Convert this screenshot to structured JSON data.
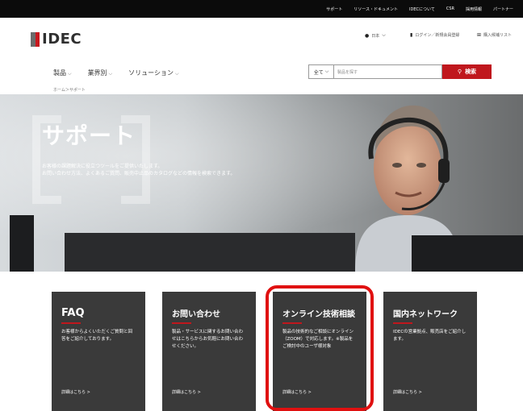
{
  "topbar": {
    "links": [
      "サポート",
      "リソース・ドキュメント",
      "IDECについて",
      "CSR",
      "採用情報",
      "パートナー"
    ]
  },
  "header": {
    "logo_text": "IDEC",
    "region_label": "日本",
    "login_label": "ログイン／新規会員登録",
    "cart_label": "購入候補リスト"
  },
  "nav": {
    "items": [
      {
        "label": "製品"
      },
      {
        "label": "業界別"
      },
      {
        "label": "ソリューション"
      }
    ]
  },
  "search": {
    "scope_value": "全て",
    "placeholder": "製品を探す",
    "button_label": "検索"
  },
  "breadcrumb": "ホーム＞サポート",
  "hero": {
    "title": "サポート",
    "desc_line1": "お客様の課題解決に役立つツールをご提供いたします。",
    "desc_line2": "お問い合わせ方法、よくあるご質問、販売中止品のカタログなどの情報を検索できます。"
  },
  "cards": [
    {
      "title": "FAQ",
      "body": "お客様からよくいただくご質問と回答をご紹介しております。",
      "more": "詳細はこちら >"
    },
    {
      "title": "お問い合わせ",
      "body": "製品・サービスに関するお問い合わせはこちらからお気軽にお問い合わせください。",
      "more": "詳細はこちら >"
    },
    {
      "title": "オンライン技術相談",
      "body": "製品の技術的なご相談にオンライン（ZOOM）で対応します。※製品をご検討中のユーザ様対象",
      "more": "詳細はこちら >"
    },
    {
      "title": "国内ネットワーク",
      "body": "IDECの営業拠点、販売店をご紹介します。",
      "more": "詳細はこちら >"
    }
  ],
  "colors": {
    "accent": "#c0171d",
    "highlight": "#e01010",
    "card_bg": "#3a3a3a",
    "topbar_bg": "#0b0b0b"
  }
}
